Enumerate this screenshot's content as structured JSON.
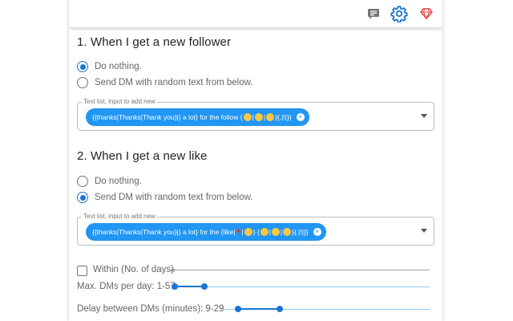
{
  "toolbar": {
    "icons": [
      "feedback-icon",
      "gear-icon",
      "gem-icon"
    ],
    "colors": {
      "gear": "#1976d2",
      "gem": "#e53935",
      "feedback": "#757575"
    }
  },
  "section1": {
    "title": "1. When I get a new follower",
    "options": [
      {
        "label": "Do nothing.",
        "selected": true
      },
      {
        "label": "Send DM with random text from below.",
        "selected": false
      }
    ],
    "field_label": "Text list, input to add new",
    "chip": {
      "text_pre": "{{thanks|Thanks|Thank you}|} a lot} for the follow {",
      "emojis": [
        "grin",
        "smile",
        "hug"
      ],
      "text_post": "}{.|!|}}"
    }
  },
  "section2": {
    "title": "2. When I get a new like",
    "options": [
      {
        "label": "Do nothing.",
        "selected": false
      },
      {
        "label": "Send DM with random text from below.",
        "selected": true
      }
    ],
    "field_label": "Text list, input to add new",
    "chip": {
      "text_pre": "{{thanks|Thanks|Thank you}|} a lot} for the {like|",
      "text_mid": "|",
      "text_mid2": "} {",
      "text_post": "}{.|!|}}"
    }
  },
  "settings": {
    "within": {
      "label": "Within (No. of days)",
      "checked": false
    },
    "max_dms": {
      "label": "Max. DMs per day: 1-57",
      "min": 1,
      "max": 57
    },
    "delay": {
      "label": "Delay between DMs (minutes): 9-29",
      "min": 9,
      "max": 29
    }
  },
  "colors": {
    "accent": "#1976d2",
    "chip": "#2196f3"
  }
}
